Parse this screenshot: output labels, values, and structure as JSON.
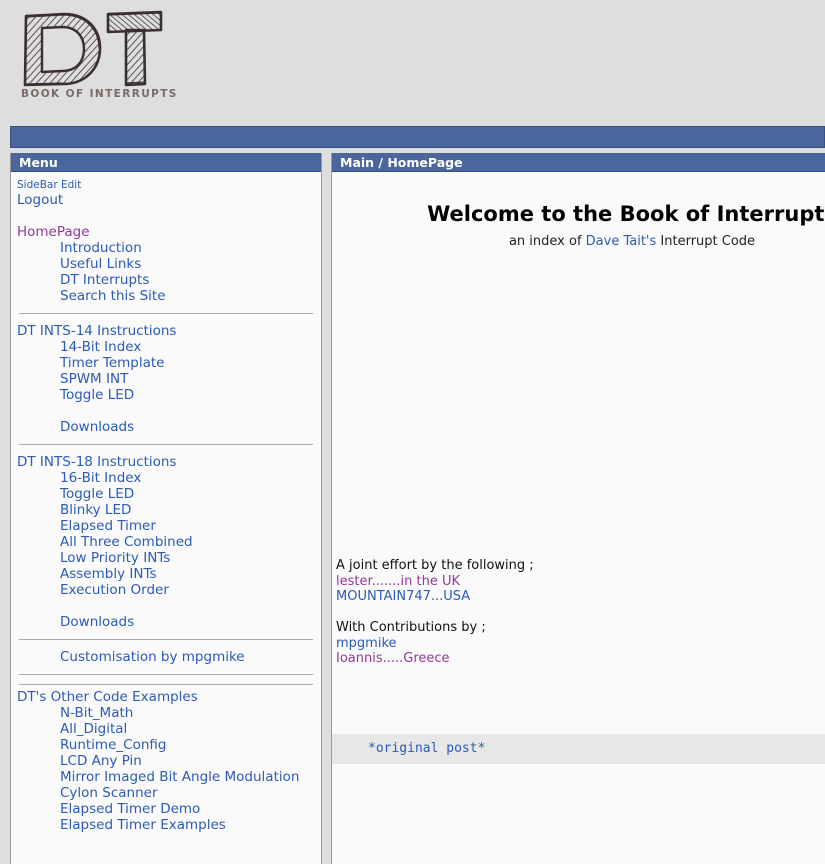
{
  "site": {
    "logo_letters": "DT",
    "tagline": "BOOK OF INTERRUPTS"
  },
  "colors": {
    "bar_blue": "#4a669c",
    "link_blue": "#2b5bb7",
    "link_visited": "#93399a",
    "page_background": "#dedede",
    "panel_background": "#fafafa",
    "code_background": "#e7e7e7",
    "tagline_gray": "#7b6a6a"
  },
  "sidebar": {
    "title": "Menu",
    "groups": [
      {
        "rule_before": false,
        "items": [
          {
            "label": "SideBar Edit",
            "style": "small",
            "indent": false,
            "visited": false
          },
          {
            "label": "Logout",
            "style": "normal",
            "indent": false,
            "visited": false
          },
          {
            "label": "",
            "style": "gap",
            "indent": false,
            "visited": false
          },
          {
            "label": "HomePage",
            "style": "normal",
            "indent": false,
            "visited": true
          },
          {
            "label": "Introduction",
            "style": "normal",
            "indent": true,
            "visited": false
          },
          {
            "label": "Useful Links",
            "style": "normal",
            "indent": true,
            "visited": false
          },
          {
            "label": "DT Interrupts",
            "style": "normal",
            "indent": true,
            "visited": false
          },
          {
            "label": "Search this Site",
            "style": "normal",
            "indent": true,
            "visited": false
          }
        ]
      },
      {
        "rule_before": true,
        "items": [
          {
            "label": "DT INTS-14 Instructions",
            "style": "normal",
            "indent": false,
            "visited": false
          },
          {
            "label": "14-Bit Index",
            "style": "normal",
            "indent": true,
            "visited": false
          },
          {
            "label": "Timer Template",
            "style": "normal",
            "indent": true,
            "visited": false
          },
          {
            "label": "SPWM INT",
            "style": "normal",
            "indent": true,
            "visited": false
          },
          {
            "label": "Toggle LED",
            "style": "normal",
            "indent": true,
            "visited": false
          },
          {
            "label": "",
            "style": "gap",
            "indent": false,
            "visited": false
          },
          {
            "label": "Downloads",
            "style": "normal",
            "indent": true,
            "visited": false
          }
        ]
      },
      {
        "rule_before": true,
        "items": [
          {
            "label": "DT INTS-18 Instructions",
            "style": "normal",
            "indent": false,
            "visited": false
          },
          {
            "label": "16-Bit Index",
            "style": "normal",
            "indent": true,
            "visited": false
          },
          {
            "label": "Toggle LED",
            "style": "normal",
            "indent": true,
            "visited": false
          },
          {
            "label": "Blinky LED",
            "style": "normal",
            "indent": true,
            "visited": false
          },
          {
            "label": "Elapsed Timer",
            "style": "normal",
            "indent": true,
            "visited": false
          },
          {
            "label": "All Three Combined",
            "style": "normal",
            "indent": true,
            "visited": false
          },
          {
            "label": "Low Priority INTs",
            "style": "normal",
            "indent": true,
            "visited": false
          },
          {
            "label": "Assembly INTs",
            "style": "normal",
            "indent": true,
            "visited": false
          },
          {
            "label": "Execution Order",
            "style": "normal",
            "indent": true,
            "visited": false
          },
          {
            "label": "",
            "style": "gap",
            "indent": false,
            "visited": false
          },
          {
            "label": "Downloads",
            "style": "normal",
            "indent": true,
            "visited": false
          }
        ]
      },
      {
        "rule_before": true,
        "items": [
          {
            "label": "Customisation by mpgmike",
            "style": "normal",
            "indent": true,
            "visited": false
          }
        ]
      },
      {
        "rule_before": true,
        "rule_double": true,
        "items": [
          {
            "label": "DT's Other Code Examples",
            "style": "normal",
            "indent": false,
            "visited": false
          },
          {
            "label": "N-Bit_Math",
            "style": "normal",
            "indent": true,
            "visited": false
          },
          {
            "label": "All_Digital",
            "style": "normal",
            "indent": true,
            "visited": false
          },
          {
            "label": "Runtime_Config",
            "style": "normal",
            "indent": true,
            "visited": false
          },
          {
            "label": "LCD Any Pin",
            "style": "normal",
            "indent": true,
            "visited": false
          },
          {
            "label": "Mirror Imaged Bit Angle Modulation",
            "style": "normal",
            "indent": true,
            "visited": false
          },
          {
            "label": "Cylon Scanner",
            "style": "normal",
            "indent": true,
            "visited": false
          },
          {
            "label": "Elapsed Timer Demo",
            "style": "normal",
            "indent": true,
            "visited": false
          },
          {
            "label": "Elapsed Timer Examples",
            "style": "normal",
            "indent": true,
            "visited": false
          }
        ]
      }
    ]
  },
  "main": {
    "breadcrumb": "Main / HomePage",
    "heading": "Welcome to the Book of Interrupts",
    "subtitle_prefix": "an index of ",
    "subtitle_link": "Dave Tait's",
    "subtitle_suffix": " Interrupt Code",
    "credits": {
      "joint_effort_label": "A joint effort by the following ;",
      "authors": [
        {
          "name": "lester.......in the UK",
          "visited": true
        },
        {
          "name": "MOUNTAIN747...USA",
          "visited": false
        }
      ],
      "contributions_label": "With Contributions by ;",
      "contributors": [
        {
          "name": "mpgmike",
          "visited": false
        },
        {
          "name": "Ioannis.....Greece",
          "visited": true
        }
      ]
    },
    "code_link": "*original post*"
  }
}
